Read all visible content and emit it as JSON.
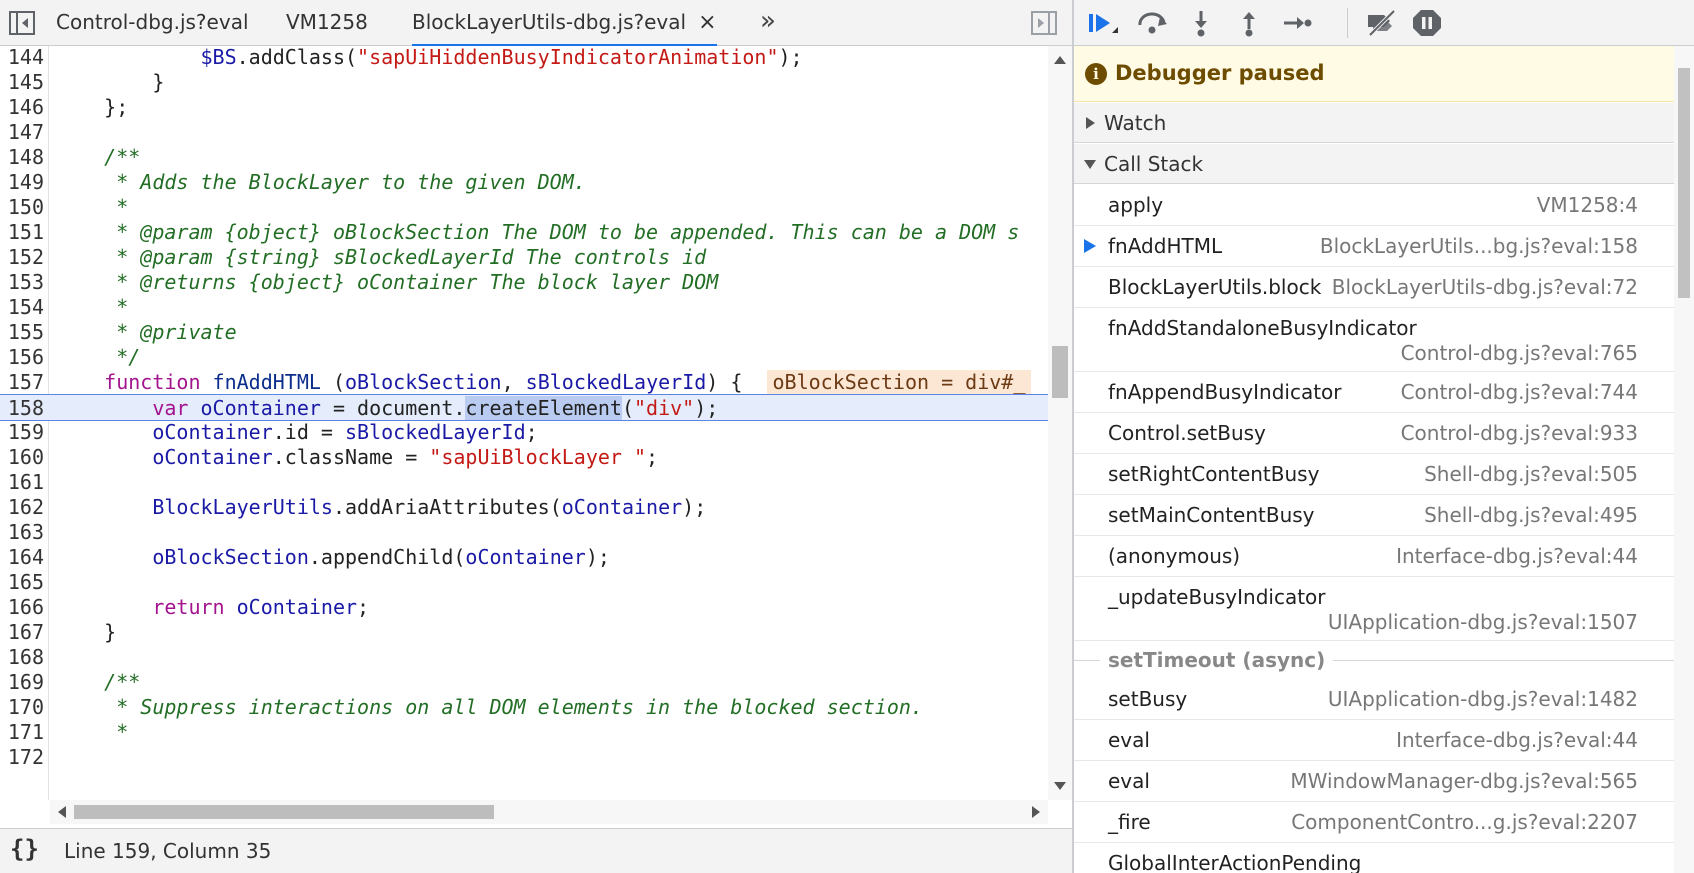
{
  "editor": {
    "tabs": [
      {
        "label": "Control-dbg.js?eval",
        "active": false
      },
      {
        "label": "VM1258",
        "active": false
      },
      {
        "label": "BlockLayerUtils-dbg.js?eval",
        "active": true
      }
    ],
    "close_glyph": "×",
    "more_tabs_glyph": "»",
    "lines": [
      {
        "num": "144",
        "tokens": [
          {
            "t": "            "
          },
          {
            "t": "$BS",
            "c": "id"
          },
          {
            "t": ".addClass("
          },
          {
            "t": "\"sapUiHiddenBusyIndicatorAnimation\"",
            "c": "str"
          },
          {
            "t": ");"
          }
        ]
      },
      {
        "num": "145",
        "tokens": [
          {
            "t": "        }"
          }
        ]
      },
      {
        "num": "146",
        "tokens": [
          {
            "t": "    };"
          }
        ]
      },
      {
        "num": "147",
        "tokens": [
          {
            "t": ""
          }
        ]
      },
      {
        "num": "148",
        "tokens": [
          {
            "t": "    /**",
            "c": "cm"
          }
        ]
      },
      {
        "num": "149",
        "tokens": [
          {
            "t": "     * Adds the BlockLayer to the given DOM.",
            "c": "cm"
          }
        ]
      },
      {
        "num": "150",
        "tokens": [
          {
            "t": "     *",
            "c": "cm"
          }
        ]
      },
      {
        "num": "151",
        "tokens": [
          {
            "t": "     * @param {object} oBlockSection The DOM to be appended. This can be a DOM s",
            "c": "cm"
          }
        ]
      },
      {
        "num": "152",
        "tokens": [
          {
            "t": "     * @param {string} sBlockedLayerId The controls id",
            "c": "cm"
          }
        ]
      },
      {
        "num": "153",
        "tokens": [
          {
            "t": "     * @returns {object} oContainer The block layer DOM",
            "c": "cm"
          }
        ]
      },
      {
        "num": "154",
        "tokens": [
          {
            "t": "     *",
            "c": "cm"
          }
        ]
      },
      {
        "num": "155",
        "tokens": [
          {
            "t": "     * @private",
            "c": "cm"
          }
        ]
      },
      {
        "num": "156",
        "tokens": [
          {
            "t": "     */",
            "c": "cm"
          }
        ]
      },
      {
        "num": "157",
        "tokens": [
          {
            "t": "    "
          },
          {
            "t": "function",
            "c": "kw"
          },
          {
            "t": " "
          },
          {
            "t": "fnAddHTML",
            "c": "fn"
          },
          {
            "t": " ("
          },
          {
            "t": "oBlockSection",
            "c": "id"
          },
          {
            "t": ", "
          },
          {
            "t": "sBlockedLayerId",
            "c": "id"
          },
          {
            "t": ") {  "
          },
          {
            "t": "oBlockSection = div#_",
            "c": "hint"
          }
        ]
      },
      {
        "num": "158",
        "exec": true,
        "tokens": [
          {
            "t": "        "
          },
          {
            "t": "var",
            "c": "kw"
          },
          {
            "t": " "
          },
          {
            "t": "oContainer",
            "c": "id"
          },
          {
            "t": " = document."
          },
          {
            "t": "createElement",
            "c": "sel"
          },
          {
            "t": "("
          },
          {
            "t": "\"div\"",
            "c": "str"
          },
          {
            "t": ");"
          }
        ]
      },
      {
        "num": "159",
        "tokens": [
          {
            "t": "        "
          },
          {
            "t": "oContainer",
            "c": "id"
          },
          {
            "t": ".id = "
          },
          {
            "t": "sBlockedLayerId",
            "c": "id"
          },
          {
            "t": ";"
          }
        ]
      },
      {
        "num": "160",
        "tokens": [
          {
            "t": "        "
          },
          {
            "t": "oContainer",
            "c": "id"
          },
          {
            "t": ".className = "
          },
          {
            "t": "\"sapUiBlockLayer \"",
            "c": "str"
          },
          {
            "t": ";"
          }
        ]
      },
      {
        "num": "161",
        "tokens": [
          {
            "t": ""
          }
        ]
      },
      {
        "num": "162",
        "tokens": [
          {
            "t": "        "
          },
          {
            "t": "BlockLayerUtils",
            "c": "id"
          },
          {
            "t": ".addAriaAttributes("
          },
          {
            "t": "oContainer",
            "c": "id"
          },
          {
            "t": ");"
          }
        ]
      },
      {
        "num": "163",
        "tokens": [
          {
            "t": ""
          }
        ]
      },
      {
        "num": "164",
        "tokens": [
          {
            "t": "        "
          },
          {
            "t": "oBlockSection",
            "c": "id"
          },
          {
            "t": ".appendChild("
          },
          {
            "t": "oContainer",
            "c": "id"
          },
          {
            "t": ");"
          }
        ]
      },
      {
        "num": "165",
        "tokens": [
          {
            "t": ""
          }
        ]
      },
      {
        "num": "166",
        "tokens": [
          {
            "t": "        "
          },
          {
            "t": "return",
            "c": "kw"
          },
          {
            "t": " "
          },
          {
            "t": "oContainer",
            "c": "id"
          },
          {
            "t": ";"
          }
        ]
      },
      {
        "num": "167",
        "tokens": [
          {
            "t": "    }"
          }
        ]
      },
      {
        "num": "168",
        "tokens": [
          {
            "t": ""
          }
        ]
      },
      {
        "num": "169",
        "tokens": [
          {
            "t": "    /**",
            "c": "cm"
          }
        ]
      },
      {
        "num": "170",
        "tokens": [
          {
            "t": "     * Suppress interactions on all DOM elements in the blocked section.",
            "c": "cm"
          }
        ]
      },
      {
        "num": "171",
        "tokens": [
          {
            "t": "     *",
            "c": "cm"
          }
        ]
      },
      {
        "num": "172",
        "tokens": [
          {
            "t": ""
          }
        ]
      }
    ]
  },
  "status": {
    "braces": "{}",
    "position": "Line 159, Column 35"
  },
  "debugger": {
    "toolbar": [
      {
        "name": "resume-button",
        "icon": "resume-icon"
      },
      {
        "name": "step-over-button",
        "icon": "step-over-icon"
      },
      {
        "name": "step-into-button",
        "icon": "step-into-icon"
      },
      {
        "name": "step-out-button",
        "icon": "step-out-icon"
      },
      {
        "name": "step-button",
        "icon": "step-icon"
      },
      {
        "name": "deactivate-breakpoints-button",
        "icon": "deactivate-breakpoints-icon"
      },
      {
        "name": "pause-on-exceptions-button",
        "icon": "pause-on-exceptions-icon"
      }
    ],
    "paused_text": "Debugger paused",
    "watch_label": "Watch",
    "callstack_label": "Call Stack",
    "frames": [
      {
        "name": "apply",
        "location": "VM1258:4"
      },
      {
        "name": "fnAddHTML",
        "location": "BlockLayerUtils...bg.js?eval:158",
        "current": true
      },
      {
        "name": "BlockLayerUtils.block",
        "location": "BlockLayerUtils-dbg.js?eval:72"
      },
      {
        "name": "fnAddStandaloneBusyIndicator",
        "location": "Control-dbg.js?eval:765",
        "wrap": true
      },
      {
        "name": "fnAppendBusyIndicator",
        "location": "Control-dbg.js?eval:744"
      },
      {
        "name": "Control.setBusy",
        "location": "Control-dbg.js?eval:933"
      },
      {
        "name": "setRightContentBusy",
        "location": "Shell-dbg.js?eval:505"
      },
      {
        "name": "setMainContentBusy",
        "location": "Shell-dbg.js?eval:495"
      },
      {
        "name": "(anonymous)",
        "location": "Interface-dbg.js?eval:44"
      },
      {
        "name": "_updateBusyIndicator",
        "location": "UIApplication-dbg.js?eval:1507",
        "wrap": true
      },
      {
        "async": "setTimeout (async)"
      },
      {
        "name": "setBusy",
        "location": "UIApplication-dbg.js?eval:1482"
      },
      {
        "name": "eval",
        "location": "Interface-dbg.js?eval:44"
      },
      {
        "name": "eval",
        "location": "MWindowManager-dbg.js?eval:565"
      },
      {
        "name": "_fire",
        "location": "ComponentContro...g.js?eval:2207"
      },
      {
        "name": "GlobalInterActionPending",
        "location": ""
      }
    ]
  },
  "colors": {
    "accent": "#1a73e8",
    "paused_banner_bg": "#fffbe5",
    "exec_line_bg": "#e5ecfb"
  }
}
